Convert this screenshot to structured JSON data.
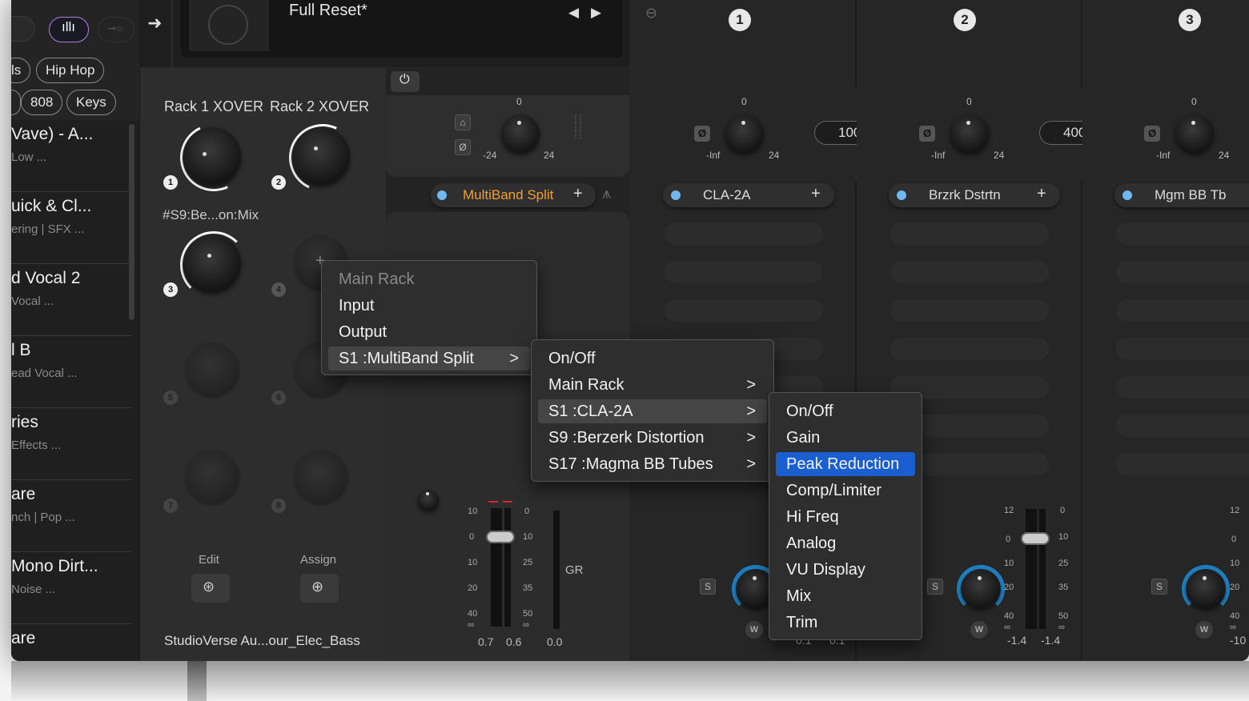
{
  "header": {
    "preset_name": "Full Reset*",
    "nav_prev": "◀",
    "nav_next": "▶",
    "arrow": "➜"
  },
  "sidebar": {
    "tags": [
      "ls",
      "Hip Hop",
      "808",
      "Keys"
    ],
    "presets": [
      {
        "title": "Vave) - A...",
        "subtitle": "Low ..."
      },
      {
        "title": "uick & Cl...",
        "subtitle": "ering | SFX ..."
      },
      {
        "title": "d Vocal 2",
        "subtitle": "Vocal ..."
      },
      {
        "title": "l B",
        "subtitle": "ead Vocal ..."
      },
      {
        "title": "ries",
        "subtitle": "Effects ..."
      },
      {
        "title": "are",
        "subtitle": "nch | Pop ..."
      },
      {
        "title": "Mono Dirt...",
        "subtitle": "Noise ..."
      },
      {
        "title": "are",
        "subtitle": ""
      }
    ]
  },
  "rack": {
    "xover1": "Rack 1 XOVER",
    "xover2": "Rack 2 XOVER",
    "macro3_label": "#S9:Be...on:Mix",
    "knob_numbers": [
      "1",
      "2",
      "3",
      "4",
      "5",
      "6",
      "7",
      "8"
    ],
    "edit_label": "Edit",
    "assign_label": "Assign",
    "preset_file": "StudioVerse Au...our_Elec_Bass"
  },
  "multiband": {
    "title": "MultiBand Split",
    "knob_top": "0",
    "knob_min": "-24",
    "knob_max": "24",
    "meter_scale_left": [
      "10",
      "0",
      "10",
      "20",
      "40",
      "∞"
    ],
    "meter_scale_right": [
      "0",
      "10",
      "25",
      "35",
      "50",
      "∞"
    ],
    "readouts": [
      "0.7",
      "0.6",
      "0.0"
    ],
    "gr_label": "GR",
    "plus": "+"
  },
  "channels": [
    {
      "number": "1",
      "plugin": "CLA-2A",
      "knob_top": "0",
      "knob_min": "-Inf",
      "knob_max": "24",
      "hz_value": "100",
      "hz_unit": "Hz",
      "readouts": [
        "0.1",
        "0.1"
      ]
    },
    {
      "number": "2",
      "plugin": "Brzrk Dstrtn",
      "knob_top": "0",
      "knob_min": "-Inf",
      "knob_max": "24",
      "hz_value": "400",
      "hz_unit": "Hz",
      "readouts": [
        "-1.4",
        "-1.4"
      ],
      "scale_left": [
        "12",
        "0",
        "10",
        "20",
        "40",
        "∞"
      ],
      "scale_right": [
        "0",
        "10",
        "25",
        "35",
        "50",
        "∞"
      ]
    },
    {
      "number": "3",
      "plugin": "Mgm BB Tb",
      "knob_top": "0",
      "knob_min": "-Inf",
      "knob_max": "24",
      "readouts": [
        "-10"
      ],
      "scale_left": [
        "12",
        "0",
        "10",
        "20",
        "40",
        "∞"
      ]
    }
  ],
  "buttons": {
    "solo": "S",
    "wet": "W",
    "plus": "+",
    "phase": "Ø"
  },
  "menu1": {
    "items": [
      {
        "label": "Main Rack",
        "disabled": true
      },
      {
        "label": "Input"
      },
      {
        "label": "Output"
      },
      {
        "label": "S1 :MultiBand Split",
        "submenu": true
      }
    ]
  },
  "menu2": {
    "items": [
      {
        "label": "On/Off"
      },
      {
        "label": "Main Rack",
        "submenu": true
      },
      {
        "label": "S1 :CLA-2A",
        "submenu": true
      },
      {
        "label": "S9 :Berzerk Distortion",
        "submenu": true
      },
      {
        "label": "S17 :Magma BB Tubes",
        "submenu": true
      }
    ]
  },
  "menu3": {
    "items": [
      {
        "label": "On/Off"
      },
      {
        "label": "Gain"
      },
      {
        "label": "Peak Reduction",
        "selected": true
      },
      {
        "label": "Comp/Limiter"
      },
      {
        "label": "Hi Freq"
      },
      {
        "label": "Analog"
      },
      {
        "label": "VU Display"
      },
      {
        "label": "Mix"
      },
      {
        "label": "Trim"
      }
    ]
  },
  "colors": {
    "accent": "#1a5ed0",
    "orange": "#f0a030",
    "led_blue": "#6fb8f0",
    "knob_arc": "#1e7fc0"
  }
}
